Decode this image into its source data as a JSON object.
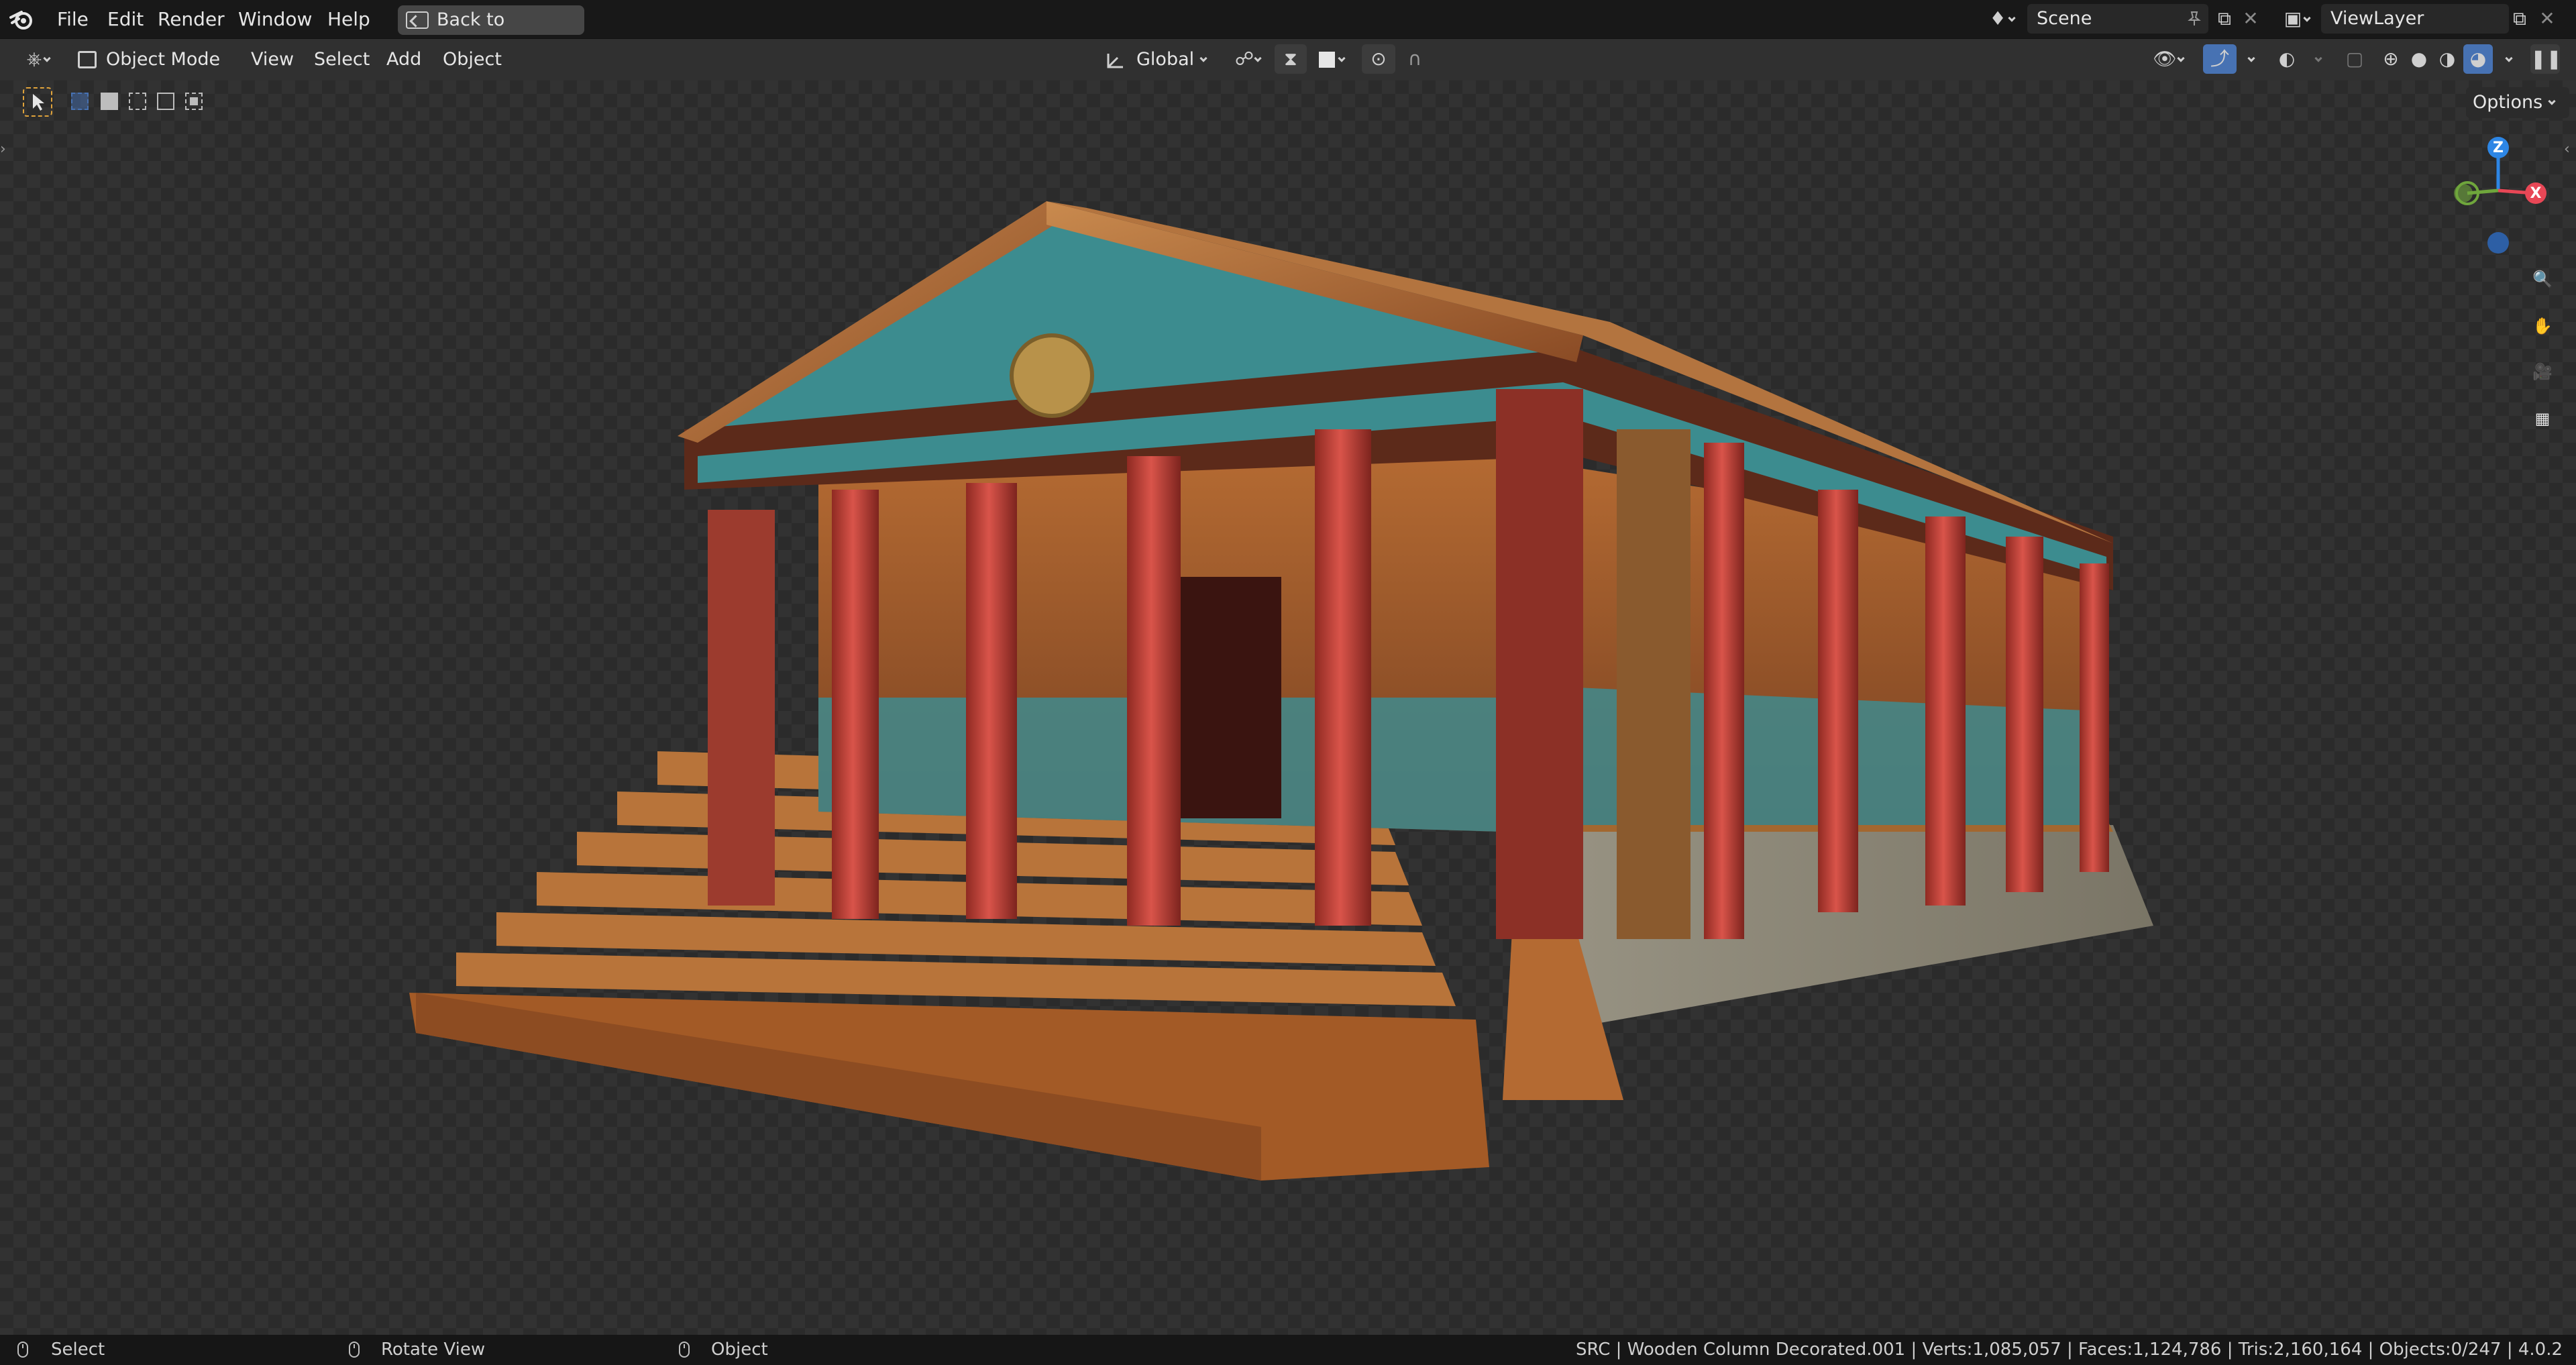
{
  "topbar": {
    "menus": [
      "File",
      "Edit",
      "Render",
      "Window",
      "Help"
    ],
    "back_button": "Back to Previous",
    "scene": "Scene",
    "view_layer": "ViewLayer"
  },
  "viewport_header": {
    "mode": "Object Mode",
    "menus": [
      "View",
      "Select",
      "Add",
      "Object"
    ],
    "orientation": "Global",
    "options": "Options"
  },
  "gizmo": {
    "z": "Z",
    "x": "X"
  },
  "statusbar": {
    "select": "Select",
    "rotate": "Rotate View",
    "object": "Object",
    "stats": "SRC | Wooden Column Decorated.001 | Verts:1,085,057 | Faces:1,124,786 | Tris:2,160,164 | Objects:0/247 | 4.0.2"
  },
  "colors": {
    "accent": "#4772b3",
    "axis_x": "#e84756",
    "axis_y": "#6fa63c",
    "axis_z": "#2d86e5"
  },
  "icons": [
    "blender-logo-icon",
    "editor-type-icon",
    "object-mode-icon",
    "orientation-icon",
    "snap-icon",
    "proportional-icon",
    "visibility-icon",
    "gizmo-icon",
    "overlay-icon",
    "xray-icon",
    "zoom-icon",
    "hand-icon",
    "camera-icon",
    "grid-icon"
  ]
}
